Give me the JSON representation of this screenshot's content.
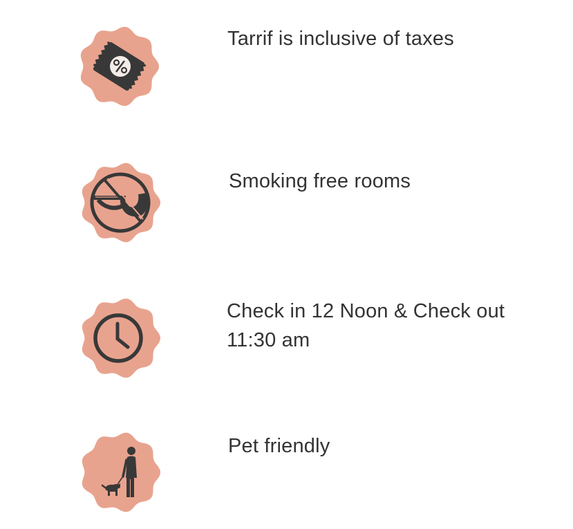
{
  "colors": {
    "badge": "#e8a38e",
    "icon": "#383838",
    "text": "#333333"
  },
  "features": [
    {
      "icon": "ticket-percent-icon",
      "text": "Tarrif is inclusive of taxes"
    },
    {
      "icon": "no-smoking-pipe-icon",
      "text": "Smoking free rooms"
    },
    {
      "icon": "clock-icon",
      "text_line1": "Check in 12 Noon & Check out",
      "text_line2": "11:30 am"
    },
    {
      "icon": "person-walking-dog-icon",
      "text": "Pet friendly"
    }
  ]
}
